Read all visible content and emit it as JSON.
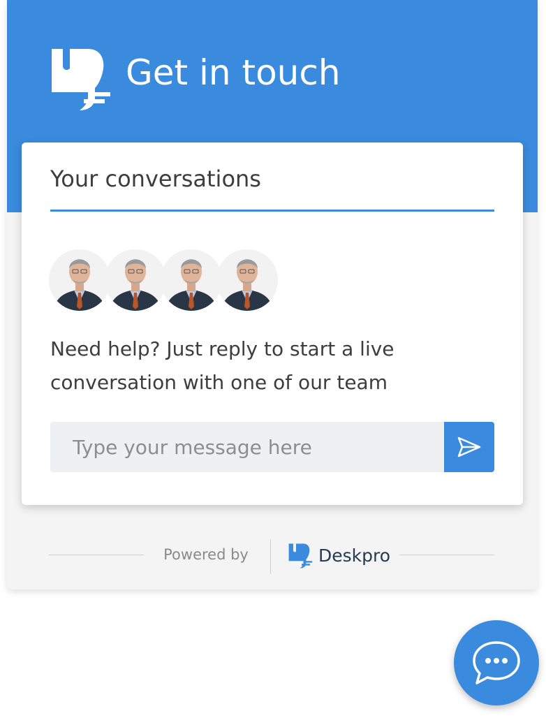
{
  "header": {
    "title": "Get in touch"
  },
  "card": {
    "title": "Your conversations",
    "help_text": "Need help? Just reply to start a live conversation with one of our team",
    "avatars": [
      {
        "name": "agent-avatar"
      },
      {
        "name": "agent-avatar"
      },
      {
        "name": "agent-avatar"
      },
      {
        "name": "agent-avatar"
      }
    ],
    "message_input": {
      "placeholder": "Type your message here",
      "value": ""
    },
    "send_icon": "send-icon"
  },
  "footer": {
    "powered_by": "Powered by",
    "brand_name": "Deskpro",
    "brand_icon": "deskpro-logo-icon"
  },
  "launcher": {
    "icon": "chat-bubble-icon"
  },
  "colors": {
    "accent": "#3a8ade",
    "background": "#f4f4f4",
    "text": "#3d3d3d",
    "input_bg": "#eef0f1"
  }
}
